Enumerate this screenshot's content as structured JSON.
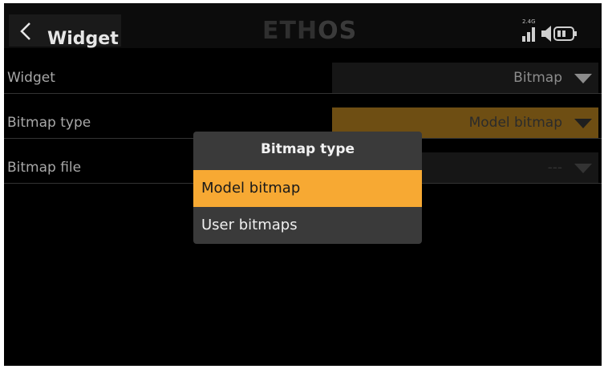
{
  "header": {
    "title": "Widget",
    "logo_left": "ETH",
    "logo_right": "OS",
    "rf_band": "2.4G",
    "icons": [
      "chevron-left-icon",
      "signal-bars-icon",
      "speaker-icon",
      "battery-icon"
    ]
  },
  "rows": [
    {
      "label": "Widget",
      "value": "Bitmap"
    },
    {
      "label": "Bitmap type",
      "value": "Model bitmap"
    },
    {
      "label": "Bitmap file",
      "value": "---"
    }
  ],
  "popup": {
    "title": "Bitmap type",
    "options": [
      {
        "label": "Model bitmap",
        "selected": true
      },
      {
        "label": "User bitmaps",
        "selected": false
      }
    ]
  },
  "colors": {
    "accent": "#f7a933",
    "active_field": "#6e4e13",
    "popup_bg": "#3a3a3a"
  }
}
